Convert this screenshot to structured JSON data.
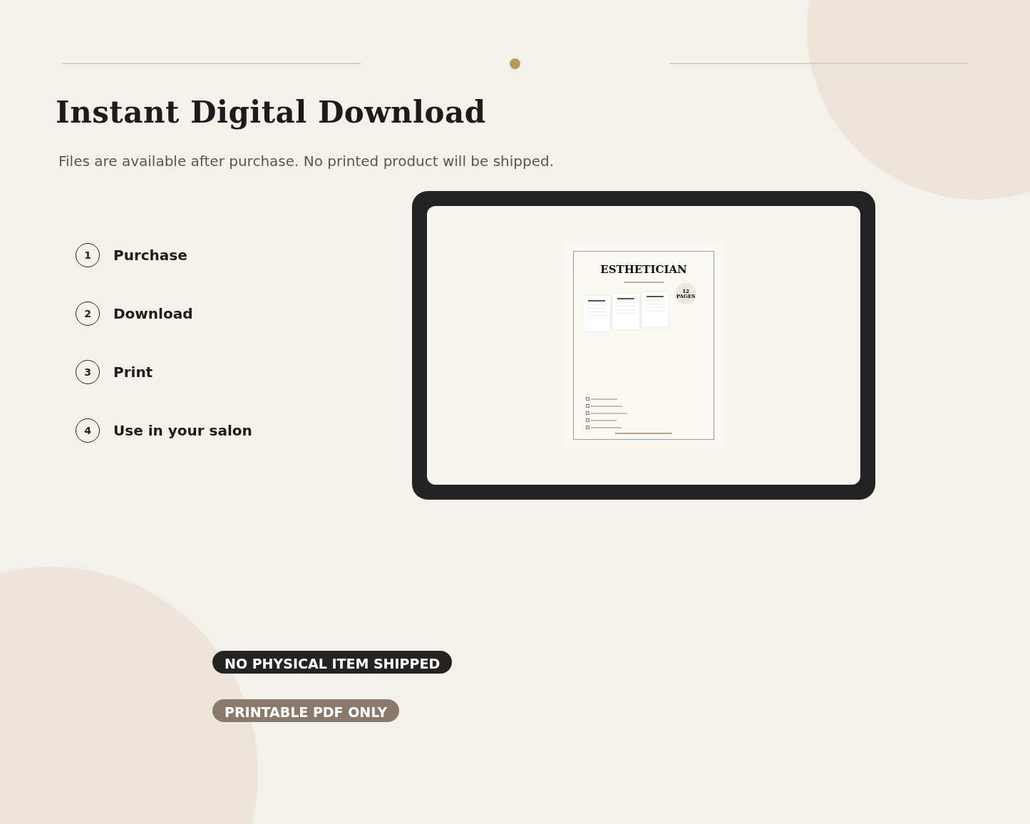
{
  "header": {
    "title": "Instant Digital Download",
    "subtitle": "Files are available after purchase. No printed product will be shipped."
  },
  "steps": [
    {
      "number": "1",
      "label": "Purchase"
    },
    {
      "number": "2",
      "label": "Download"
    },
    {
      "number": "3",
      "label": "Print"
    },
    {
      "number": "4",
      "label": "Use in your salon"
    }
  ],
  "preview": {
    "title": "ESTHETICIAN",
    "badge": "12 PAGES"
  },
  "tags": [
    {
      "label": "NO PHYSICAL ITEM SHIPPED",
      "color": "#252321"
    },
    {
      "label": "PRINTABLE PDF ONLY",
      "color": "#8a7a6b"
    }
  ]
}
